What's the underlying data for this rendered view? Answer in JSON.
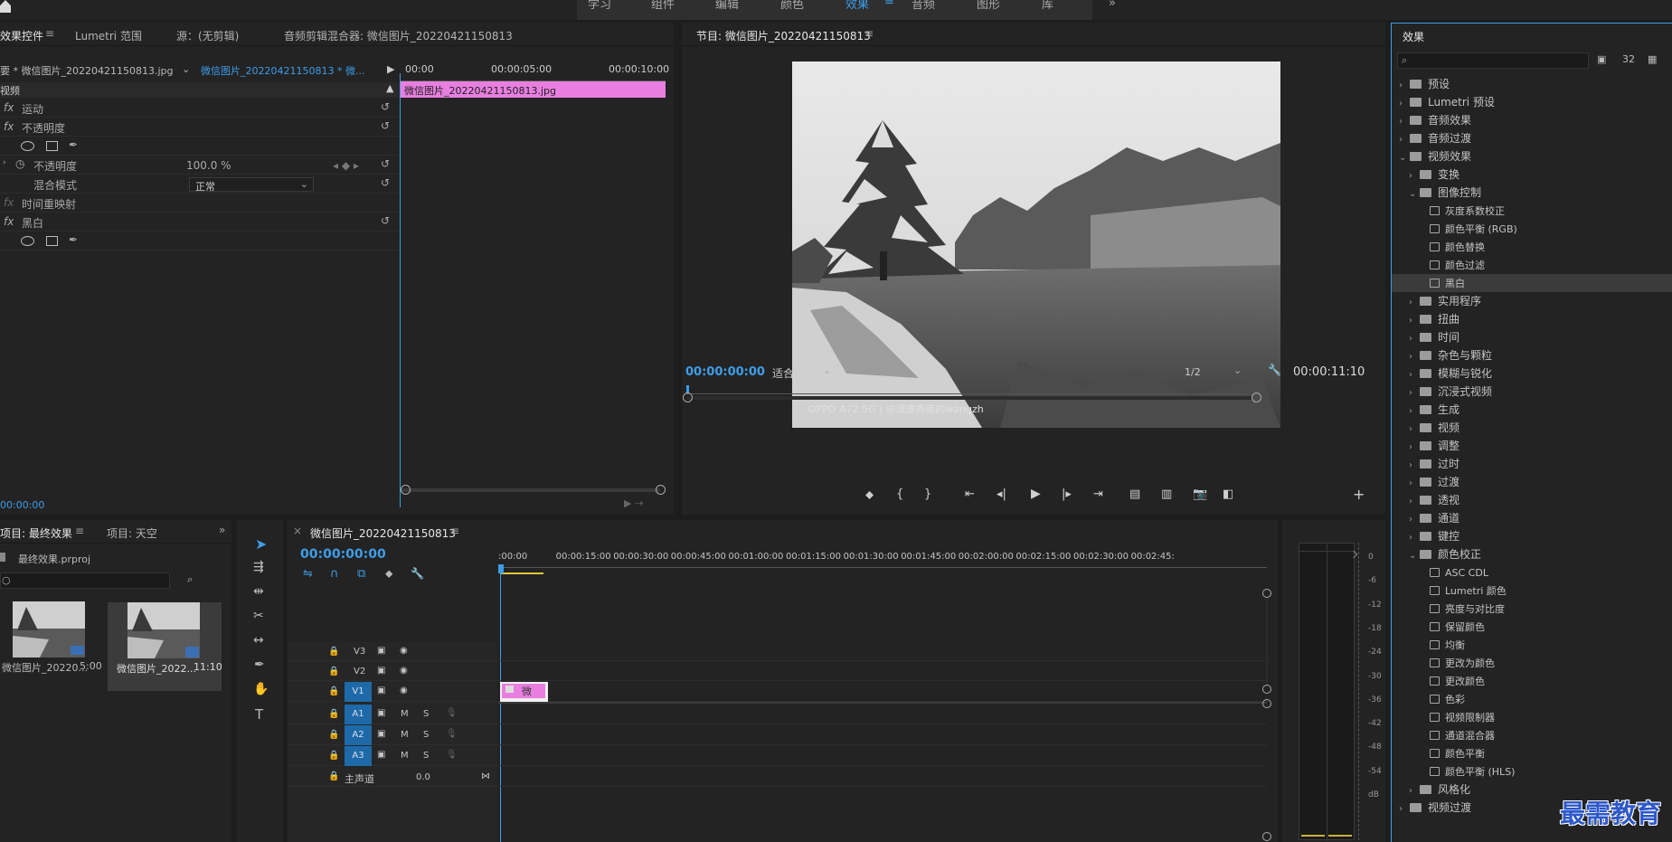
{
  "workspaces": [
    "学习",
    "组件",
    "编辑",
    "颜色",
    "效果",
    "音频",
    "图形",
    "库"
  ],
  "active_workspace": "效果",
  "effect_controls": {
    "tabs": [
      "效果控件",
      "Lumetri 范围",
      "源：(无剪辑)",
      "音频剪辑混合器: 微信图片_20220421150813"
    ],
    "clip_master": "要 * 微信图片_20220421150813.jpg",
    "clip_seq": "微信图片_20220421150813 * 微...",
    "timecodes": [
      "00:00",
      "00:00:05:00",
      "00:00:10:00"
    ],
    "clip_bar_label": "微信图片_20220421150813.jpg",
    "section_video": "视频",
    "effects": [
      {
        "label": "运动"
      },
      {
        "label": "不透明度"
      },
      {
        "label": "不透明度",
        "value": "100.0 %"
      },
      {
        "label": "混合模式",
        "value": "正常"
      },
      {
        "label": "时间重映射"
      },
      {
        "label": "黑白"
      }
    ],
    "current_time": "00:00:00"
  },
  "program": {
    "title": "节目: 微信图片_20220421150813",
    "watermark": "OPPO A72 5G | @流速秀美的wangzh",
    "timecode_in": "00:00:00:00",
    "fit": "适合",
    "resolution": "1/2",
    "duration": "00:00:11:10"
  },
  "effects_panel": {
    "title": "效果",
    "tree": [
      {
        "label": "预设",
        "type": "folder",
        "indent": 0,
        "open": false
      },
      {
        "label": "Lumetri 预设",
        "type": "folder",
        "indent": 0,
        "open": false
      },
      {
        "label": "音频效果",
        "type": "folder",
        "indent": 0,
        "open": false
      },
      {
        "label": "音频过渡",
        "type": "folder",
        "indent": 0,
        "open": false
      },
      {
        "label": "视频效果",
        "type": "folder",
        "indent": 0,
        "open": true
      },
      {
        "label": "变换",
        "type": "folder",
        "indent": 1,
        "open": false
      },
      {
        "label": "图像控制",
        "type": "folder",
        "indent": 1,
        "open": true
      },
      {
        "label": "灰度系数校正",
        "type": "fx",
        "indent": 2
      },
      {
        "label": "颜色平衡 (RGB)",
        "type": "fx",
        "indent": 2
      },
      {
        "label": "颜色替换",
        "type": "fx",
        "indent": 2
      },
      {
        "label": "颜色过滤",
        "type": "fx",
        "indent": 2
      },
      {
        "label": "黑白",
        "type": "fx",
        "indent": 2,
        "selected": true
      },
      {
        "label": "实用程序",
        "type": "folder",
        "indent": 1,
        "open": false
      },
      {
        "label": "扭曲",
        "type": "folder",
        "indent": 1,
        "open": false
      },
      {
        "label": "时间",
        "type": "folder",
        "indent": 1,
        "open": false
      },
      {
        "label": "杂色与颗粒",
        "type": "folder",
        "indent": 1,
        "open": false
      },
      {
        "label": "模糊与锐化",
        "type": "folder",
        "indent": 1,
        "open": false
      },
      {
        "label": "沉浸式视频",
        "type": "folder",
        "indent": 1,
        "open": false
      },
      {
        "label": "生成",
        "type": "folder",
        "indent": 1,
        "open": false
      },
      {
        "label": "视频",
        "type": "folder",
        "indent": 1,
        "open": false
      },
      {
        "label": "调整",
        "type": "folder",
        "indent": 1,
        "open": false
      },
      {
        "label": "过时",
        "type": "folder",
        "indent": 1,
        "open": false
      },
      {
        "label": "过渡",
        "type": "folder",
        "indent": 1,
        "open": false
      },
      {
        "label": "透视",
        "type": "folder",
        "indent": 1,
        "open": false
      },
      {
        "label": "通道",
        "type": "folder",
        "indent": 1,
        "open": false
      },
      {
        "label": "键控",
        "type": "folder",
        "indent": 1,
        "open": false
      },
      {
        "label": "颜色校正",
        "type": "folder",
        "indent": 1,
        "open": true
      },
      {
        "label": "ASC CDL",
        "type": "fx",
        "indent": 2
      },
      {
        "label": "Lumetri 颜色",
        "type": "fx",
        "indent": 2
      },
      {
        "label": "亮度与对比度",
        "type": "fx",
        "indent": 2
      },
      {
        "label": "保留颜色",
        "type": "fx",
        "indent": 2
      },
      {
        "label": "均衡",
        "type": "fx",
        "indent": 2
      },
      {
        "label": "更改为颜色",
        "type": "fx",
        "indent": 2
      },
      {
        "label": "更改颜色",
        "type": "fx",
        "indent": 2
      },
      {
        "label": "色彩",
        "type": "fx",
        "indent": 2
      },
      {
        "label": "视频限制器",
        "type": "fx",
        "indent": 2
      },
      {
        "label": "通道混合器",
        "type": "fx",
        "indent": 2
      },
      {
        "label": "颜色平衡",
        "type": "fx",
        "indent": 2
      },
      {
        "label": "颜色平衡 (HLS)",
        "type": "fx",
        "indent": 2
      },
      {
        "label": "风格化",
        "type": "folder",
        "indent": 1,
        "open": false
      },
      {
        "label": "视频过渡",
        "type": "folder",
        "indent": 0,
        "open": false
      }
    ]
  },
  "project": {
    "tabs": [
      "项目: 最终效果",
      "项目: 天空"
    ],
    "file": "最终效果.prproj",
    "items": [
      {
        "name": "微信图片_20220...",
        "duration": "5:00"
      },
      {
        "name": "微信图片_2022...",
        "duration": "11:10"
      }
    ]
  },
  "timeline": {
    "tab": "微信图片_20220421150813",
    "timecode": "00:00:00:00",
    "ruler": [
      ":00:00",
      "00:00:15:00",
      "00:00:30:00",
      "00:00:45:00",
      "00:01:00:00",
      "00:01:15:00",
      "00:01:30:00",
      "00:01:45:00",
      "00:02:00:00",
      "00:02:15:00",
      "00:02:30:00",
      "00:02:45:"
    ],
    "video_tracks": [
      "V3",
      "V2",
      "V1"
    ],
    "audio_tracks": [
      "A1",
      "A2",
      "A3"
    ],
    "mix_label": "主声道",
    "mix_value": "0.0",
    "clip_label": "微"
  },
  "meter_labels": [
    "0",
    "-6",
    "-12",
    "-18",
    "-24",
    "-30",
    "-36",
    "-42",
    "-48",
    "-54",
    "dB"
  ],
  "watermark_logo": "最需教育"
}
